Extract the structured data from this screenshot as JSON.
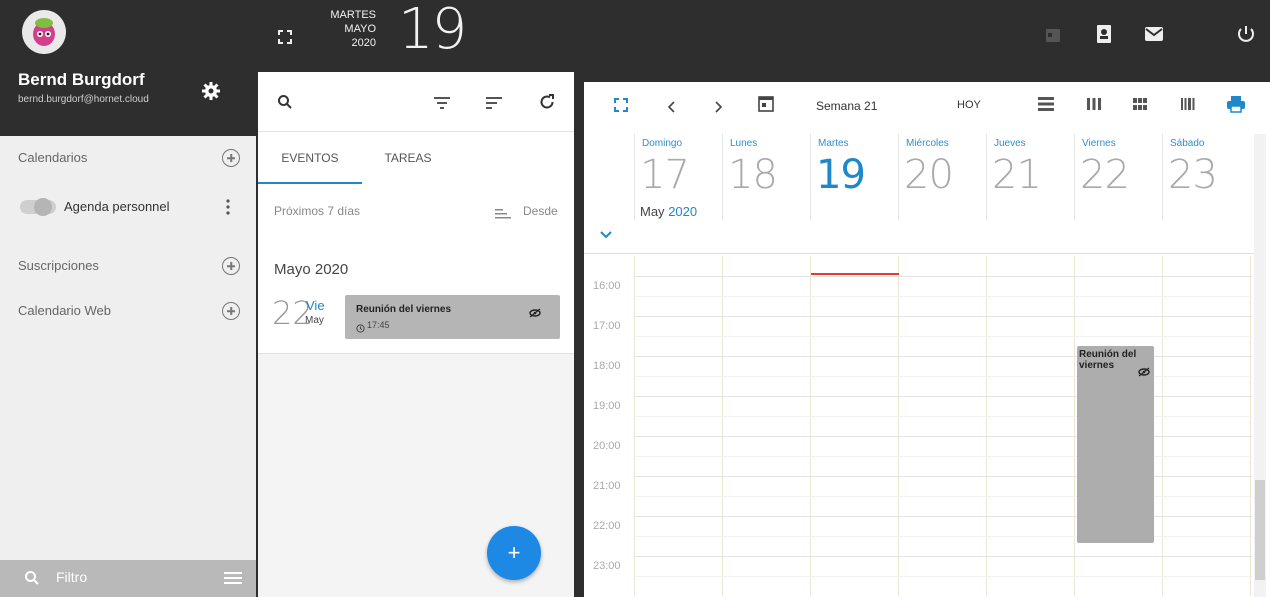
{
  "topbar": {
    "weekday": "MARTES",
    "month": "MAYO",
    "year": "2020",
    "day": "19",
    "icons": [
      "expand-icon",
      "calendar-icon",
      "contacts-icon",
      "mail-icon",
      "power-icon"
    ]
  },
  "user": {
    "name": "Bernd Burgdorf",
    "email": "bernd.burgdorf@hornet.cloud"
  },
  "sidebar": {
    "calendars_label": "Calendarios",
    "agenda_label": "Agenda personnel",
    "subscriptions_label": "Suscripciones",
    "webcal_label": "Calendario Web",
    "filter_placeholder": "Filtro"
  },
  "agenda": {
    "tabs": [
      "EVENTOS",
      "TAREAS"
    ],
    "next_days_label": "Próximos 7 días",
    "sort_label": "Desde",
    "month_title": "Mayo 2020",
    "event": {
      "day_number": "22",
      "day_name": "Vie",
      "month_short": "May",
      "title": "Reunión del viernes",
      "time": "17:45"
    },
    "fab_label": "+"
  },
  "calendar": {
    "week_label": "Semana 21",
    "today_label": "HOY",
    "days": [
      {
        "name": "Domingo",
        "num": "17"
      },
      {
        "name": "Lunes",
        "num": "18"
      },
      {
        "name": "Martes",
        "num": "19"
      },
      {
        "name": "Miércoles",
        "num": "20"
      },
      {
        "name": "Jueves",
        "num": "21"
      },
      {
        "name": "Viernes",
        "num": "22"
      },
      {
        "name": "Sábado",
        "num": "23"
      }
    ],
    "month_label": "May",
    "year_label": "2020",
    "hours": [
      "16:00",
      "17:00",
      "18:00",
      "19:00",
      "20:00",
      "21:00",
      "22:00",
      "23:00"
    ],
    "event_title": "Reunión del viernes"
  },
  "colors": {
    "accent": "#1e88c8",
    "today": "#1e88c8",
    "now_line": "#e53935",
    "event_bg": "#adadad"
  }
}
